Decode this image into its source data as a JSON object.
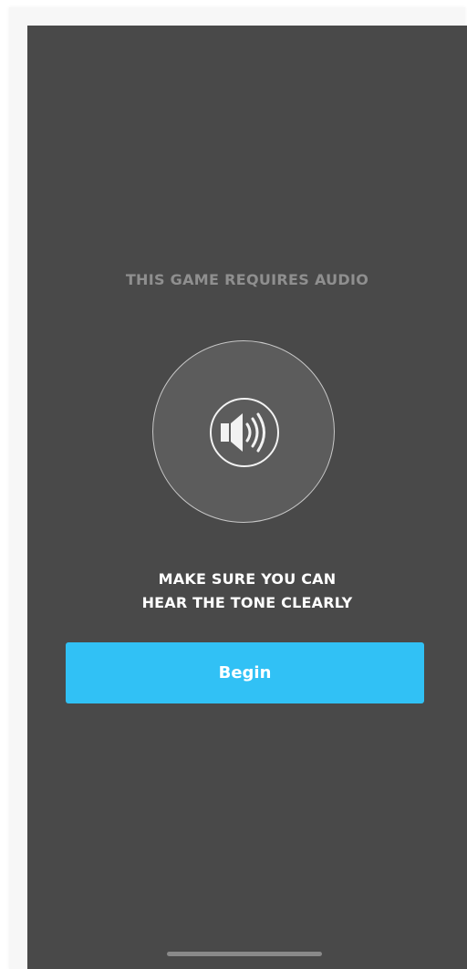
{
  "screen": {
    "heading": "THIS GAME REQUIRES AUDIO",
    "icon": "speaker-icon",
    "instruction_line1": "MAKE SURE YOU CAN",
    "instruction_line2": "HEAR THE TONE CLEARLY",
    "begin_label": "Begin"
  },
  "colors": {
    "background": "#494949",
    "accent": "#31c1f5",
    "circle_fill": "#5c5c5c",
    "heading_text": "#8f8f8f"
  }
}
